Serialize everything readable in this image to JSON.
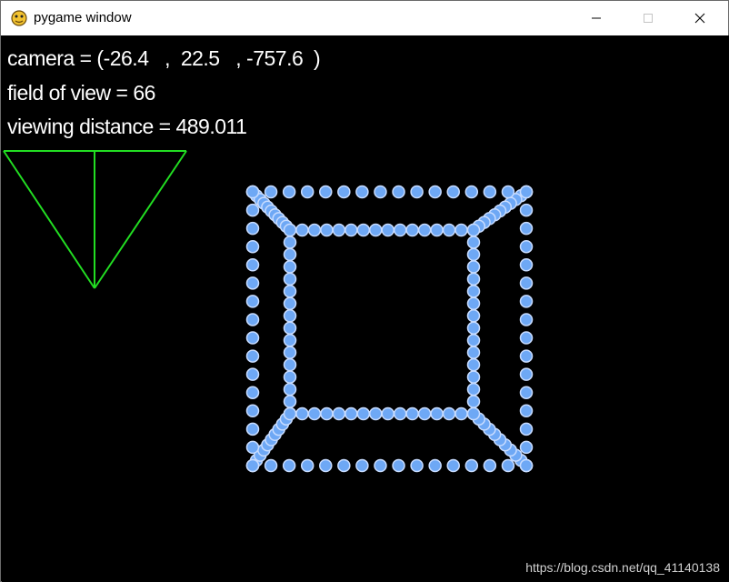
{
  "window": {
    "title": "pygame window",
    "app_icon": "python-snake-icon",
    "controls": {
      "minimize": "minimize-icon",
      "maximize": "maximize-icon",
      "close": "close-icon"
    }
  },
  "hud": {
    "camera": "camera = (-26.4   ,  22.5   , -757.6  )",
    "field_of_view": "field of view = 66",
    "viewing_distance": "viewing distance = 489.011"
  },
  "scene": {
    "background": "#000000",
    "point_color": "#6ea8f5",
    "point_outline": "#c8dcff",
    "frustum_color": "#22dd22"
  },
  "watermark": "https://blog.csdn.net/qq_41140138"
}
